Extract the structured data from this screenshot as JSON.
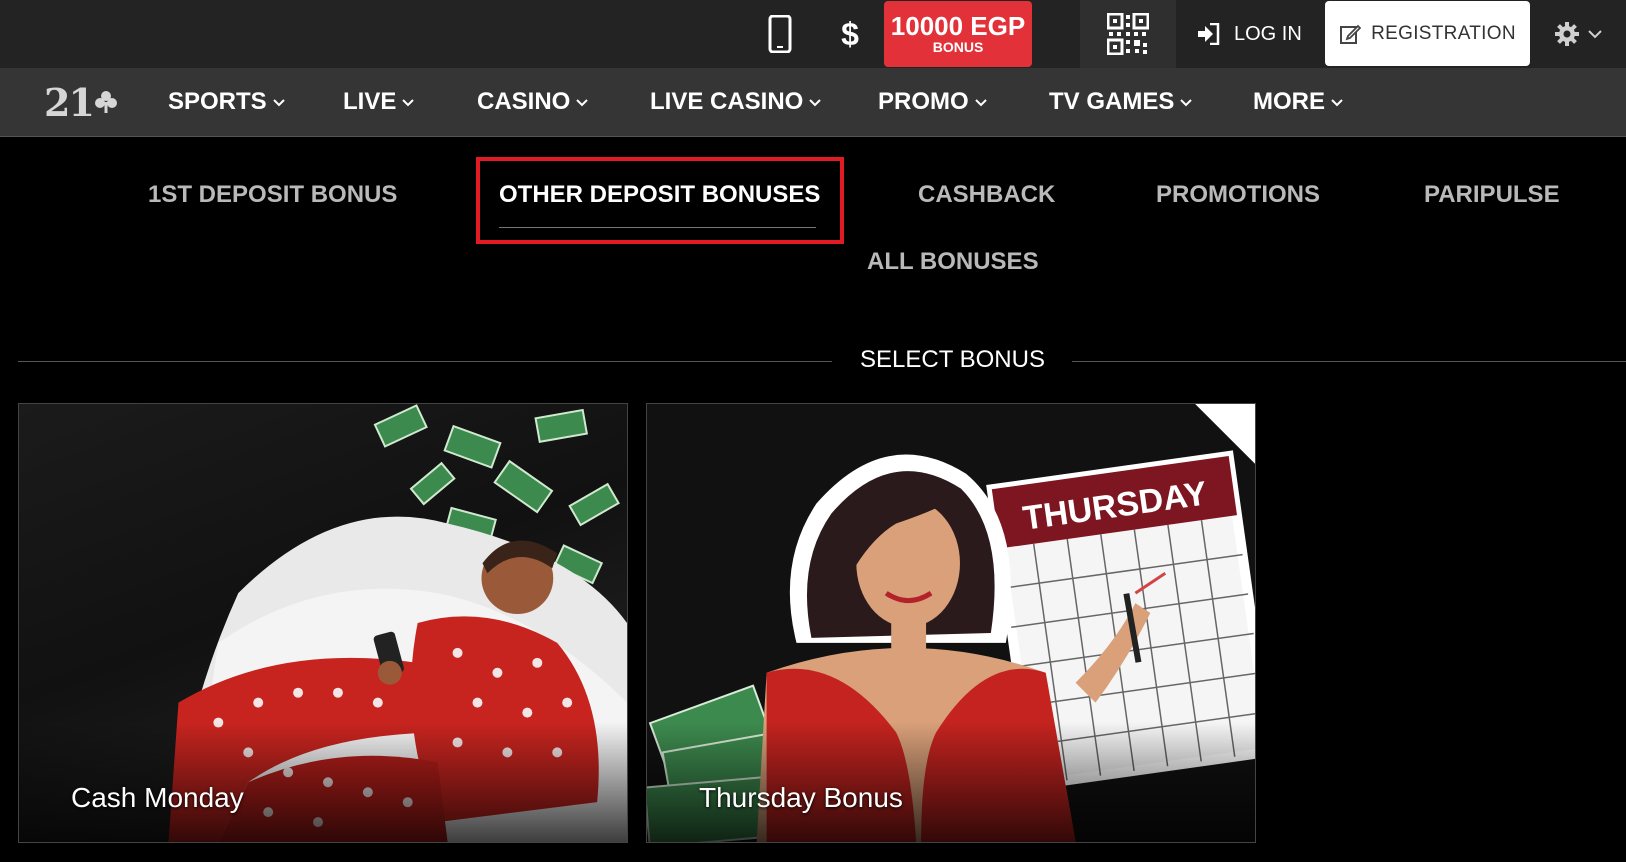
{
  "topbar": {
    "mobile_icon": "mobile-phone-icon",
    "currency_symbol": "$",
    "bonus": {
      "amount": "10000 EGP",
      "label": "BONUS"
    },
    "qr_icon": "qr-code-icon",
    "login_label": "LOG IN",
    "registration_label": "REGISTRATION",
    "settings_icon": "gear-icon"
  },
  "logo": {
    "text": "21"
  },
  "nav": {
    "items": [
      {
        "label": "SPORTS"
      },
      {
        "label": "LIVE"
      },
      {
        "label": "CASINO"
      },
      {
        "label": "LIVE CASINO"
      },
      {
        "label": "PROMO"
      },
      {
        "label": "TV GAMES"
      },
      {
        "label": "MORE"
      }
    ]
  },
  "subnav": {
    "items": [
      {
        "label": "1ST DEPOSIT BONUS"
      },
      {
        "label": "OTHER DEPOSIT BONUSES",
        "active": true
      },
      {
        "label": "CASHBACK"
      },
      {
        "label": "PROMOTIONS"
      },
      {
        "label": "PARIPULSE"
      },
      {
        "label": "ALL BONUSES"
      }
    ]
  },
  "section": {
    "title": "SELECT BONUS"
  },
  "cards": [
    {
      "title": "Cash Monday"
    },
    {
      "title": "Thursday Bonus",
      "calendar_text": "THURSDAY"
    }
  ],
  "colors": {
    "accent_red": "#e3313a",
    "highlight_border": "#e01b24",
    "topbar_bg": "#232323",
    "nav_bg": "#353535"
  }
}
